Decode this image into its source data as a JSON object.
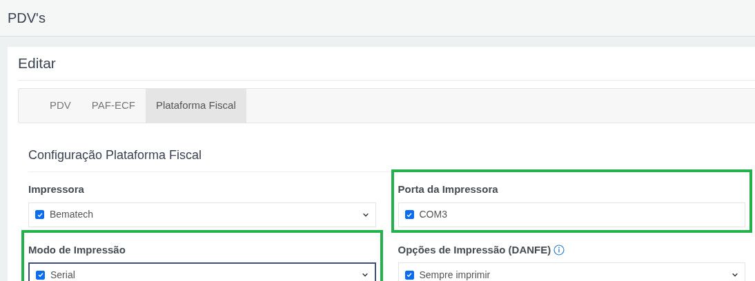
{
  "page_title": "PDV's",
  "card_title": "Editar",
  "tabs": [
    {
      "label": "PDV",
      "selected": false
    },
    {
      "label": "PAF-ECF",
      "selected": false
    },
    {
      "label": "Plataforma Fiscal",
      "selected": true
    }
  ],
  "section_title": "Configuração Plataforma Fiscal",
  "fields": [
    {
      "kind": "select",
      "label": "Impressora",
      "value": "Bematech",
      "checked": true,
      "highlighted": false,
      "focused": false,
      "has_info": false
    },
    {
      "kind": "input",
      "label": "Porta da Impressora",
      "value": "COM3",
      "checked": true,
      "highlighted": true,
      "focused": false,
      "has_info": false
    },
    {
      "kind": "select",
      "label": "Modo de Impressão",
      "value": "Serial",
      "checked": true,
      "highlighted": true,
      "focused": true,
      "has_info": false
    },
    {
      "kind": "select",
      "label": "Opções de Impressão (DANFE)",
      "value": "Sempre imprimir",
      "checked": true,
      "highlighted": false,
      "focused": false,
      "has_info": true
    }
  ]
}
